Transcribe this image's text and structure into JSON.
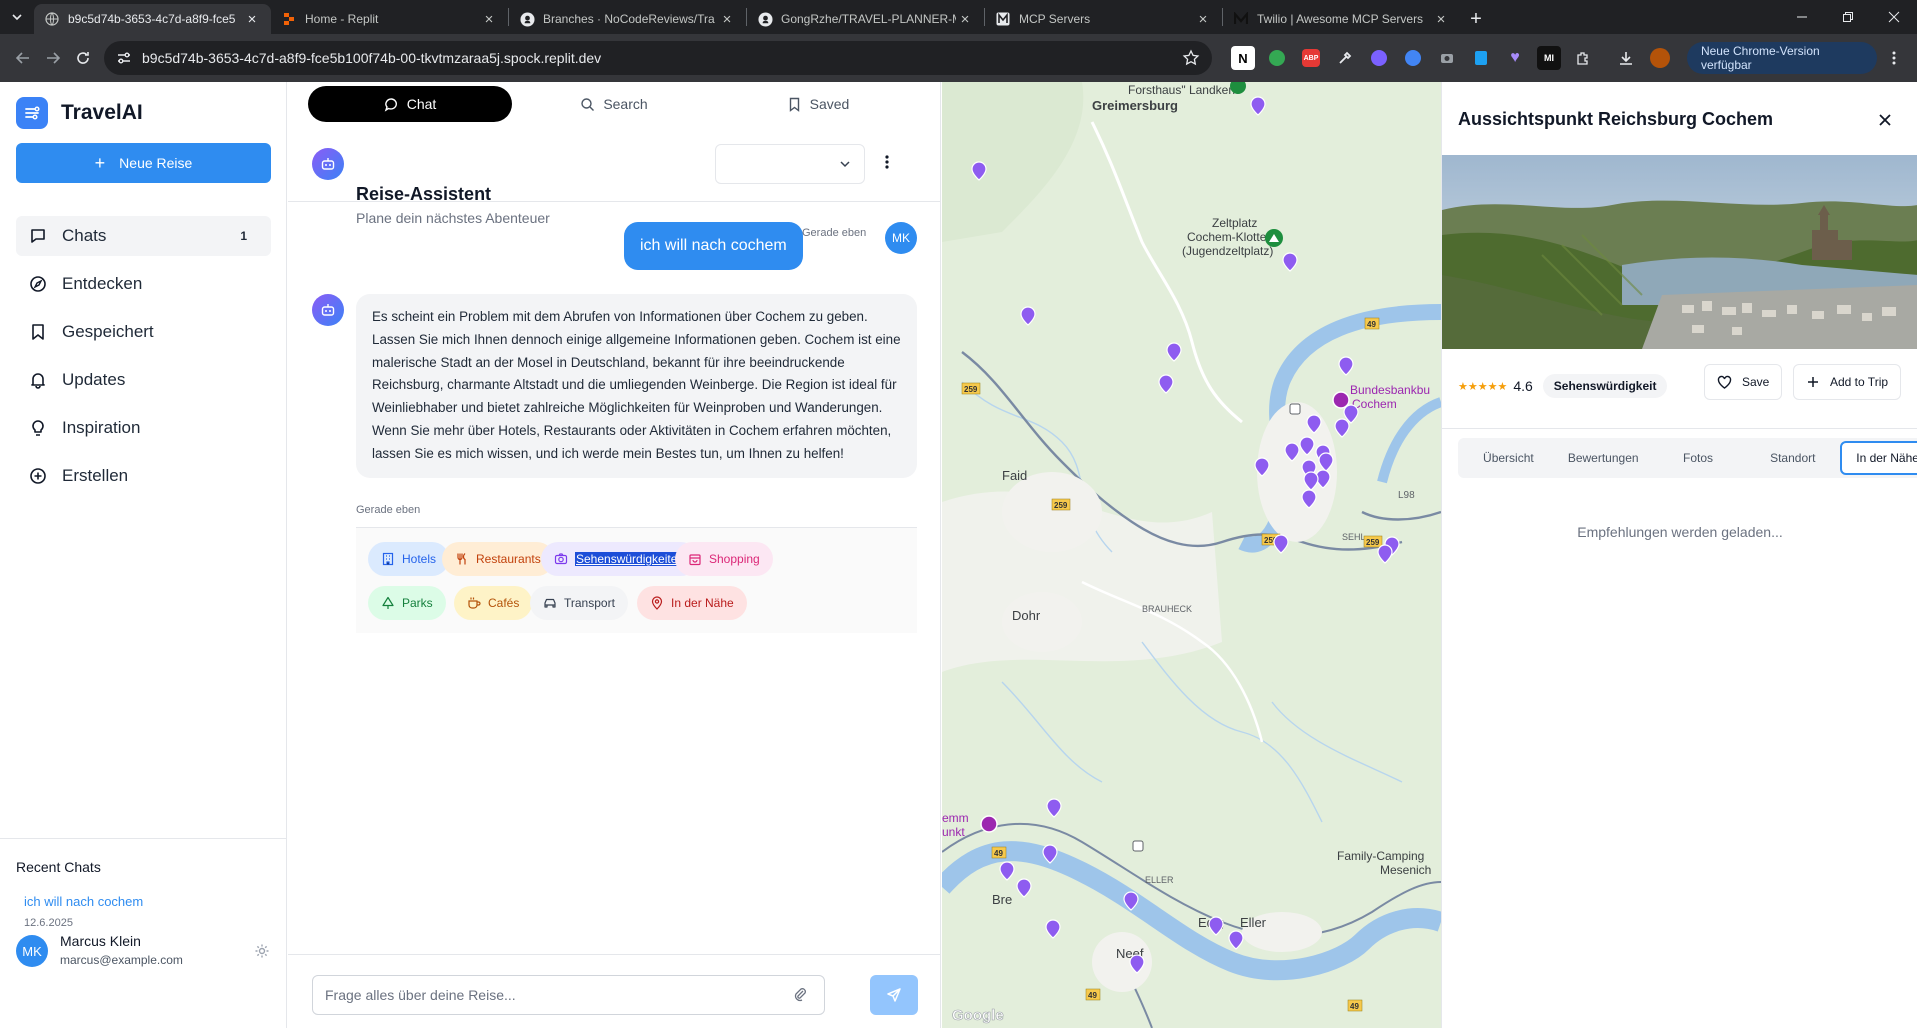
{
  "browser": {
    "tabs": [
      {
        "label": "b9c5d74b-3653-4c7d-a8f9-fce5",
        "active": true
      },
      {
        "label": "Home - Replit",
        "active": false
      },
      {
        "label": "Branches · NoCodeReviews/Tra",
        "active": false
      },
      {
        "label": "GongRzhe/TRAVEL-PLANNER-M",
        "active": false
      },
      {
        "label": "MCP Servers",
        "active": false
      },
      {
        "label": "Twilio | Awesome MCP Servers",
        "active": false
      }
    ],
    "url": "b9c5d74b-3653-4c7d-a8f9-fce5b100f74b-00-tkvtmzaraa5j.spock.replit.dev",
    "update_label": "Neue Chrome-Version verfügbar"
  },
  "sidebar": {
    "brand": "TravelAI",
    "new_trip": "Neue Reise",
    "nav": [
      {
        "label": "Chats",
        "badge": "1",
        "icon": "chat-bubble-icon",
        "active": true
      },
      {
        "label": "Entdecken",
        "badge": "",
        "icon": "compass-icon",
        "active": false
      },
      {
        "label": "Gespeichert",
        "badge": "",
        "icon": "bookmark-icon",
        "active": false
      },
      {
        "label": "Updates",
        "badge": "",
        "icon": "bell-icon",
        "active": false
      },
      {
        "label": "Inspiration",
        "badge": "",
        "icon": "lightbulb-icon",
        "active": false
      },
      {
        "label": "Erstellen",
        "badge": "",
        "icon": "plus-circle-icon",
        "active": false
      }
    ],
    "recent_heading": "Recent Chats",
    "recent": [
      {
        "title": "ich will nach cochem",
        "date": "12.6.2025"
      }
    ],
    "user": {
      "initials": "MK",
      "name": "Marcus Klein",
      "email": "marcus@example.com"
    }
  },
  "chat": {
    "tabs": [
      {
        "label": "Chat",
        "icon": "chat-bubble-icon",
        "active": true
      },
      {
        "label": "Search",
        "icon": "search-icon",
        "active": false
      },
      {
        "label": "Saved",
        "icon": "bookmark-icon",
        "active": false
      }
    ],
    "title": "Reise-Assistent",
    "subtitle": "Plane dein nächstes Abenteuer",
    "messages": {
      "user_text": "ich will nach cochem",
      "user_time": "Gerade eben",
      "user_initials": "MK",
      "bot_text": "Es scheint ein Problem mit dem Abrufen von Informationen über Cochem zu geben. Lassen Sie mich Ihnen dennoch einige allgemeine Informationen geben. Cochem ist eine malerische Stadt an der Mosel in Deutschland, bekannt für ihre beeindruckende Reichsburg, charmante Altstadt und die umliegenden Weinberge. Die Region ist ideal für Weinliebhaber und bietet zahlreiche Möglichkeiten für Weinproben und Wanderungen. Wenn Sie mehr über Hotels, Restaurants oder Aktivitäten in Cochem erfahren möchten, lassen Sie es mich wissen, und ich werde mein Bestes tun, um Ihnen zu helfen!",
      "bot_time": "Gerade eben"
    },
    "categories": [
      {
        "label": "Hotels",
        "icon": "hotel-icon",
        "color": "#2563eb",
        "bg": "#dbeafe"
      },
      {
        "label": "Restaurants",
        "icon": "utensils-icon",
        "color": "#c2410c",
        "bg": "#ffedd5"
      },
      {
        "label": "Sehenswürdigkeiten",
        "icon": "camera-icon",
        "color": "#7c3aed",
        "bg": "#ede9fe"
      },
      {
        "label": "Shopping",
        "icon": "shopping-bag-icon",
        "color": "#db2777",
        "bg": "#fce7f3"
      },
      {
        "label": "Parks",
        "icon": "tree-icon",
        "color": "#15803d",
        "bg": "#dcfce7"
      },
      {
        "label": "Cafés",
        "icon": "coffee-icon",
        "color": "#b45309",
        "bg": "#fef3c7"
      },
      {
        "label": "Transport",
        "icon": "car-icon",
        "color": "#374151",
        "bg": "#f3f4f6"
      },
      {
        "label": "In der Nähe",
        "icon": "map-pin-icon",
        "color": "#b91c1c",
        "bg": "#fee2e2"
      }
    ],
    "input_placeholder": "Frage alles über deine Reise..."
  },
  "map": {
    "labels": [
      "Forsthaus\" Landkern",
      "Greimersburg",
      "Zeltplatz",
      "Cochem-Klotten",
      "(Jugendzeltplatz)",
      "Bundesbankbu",
      "Cochem",
      "Faid",
      "Dohr",
      "BRAUHECK",
      "Family-Camping",
      "Mesenich",
      "Edig",
      "Eller",
      "Neef",
      "Bre",
      "emm",
      "unkt",
      "ELLER",
      "SEHL",
      "L98",
      "Google"
    ],
    "road_shields": [
      "259",
      "49",
      "259",
      "259",
      "259",
      "49",
      "49",
      "49"
    ]
  },
  "detail": {
    "title": "Aussichtspunkt Reichsburg Cochem",
    "rating": "4.6",
    "stars": "★★★★★",
    "category": "Sehenswürdigkeit",
    "save_label": "Save",
    "add_label": "Add to Trip",
    "tabs": [
      {
        "label": "Übersicht",
        "active": false
      },
      {
        "label": "Bewertungen",
        "active": false
      },
      {
        "label": "Fotos",
        "active": false
      },
      {
        "label": "Standort",
        "active": false
      },
      {
        "label": "In der Nähe",
        "active": true
      }
    ],
    "loading_text": "Empfehlungen werden geladen..."
  }
}
